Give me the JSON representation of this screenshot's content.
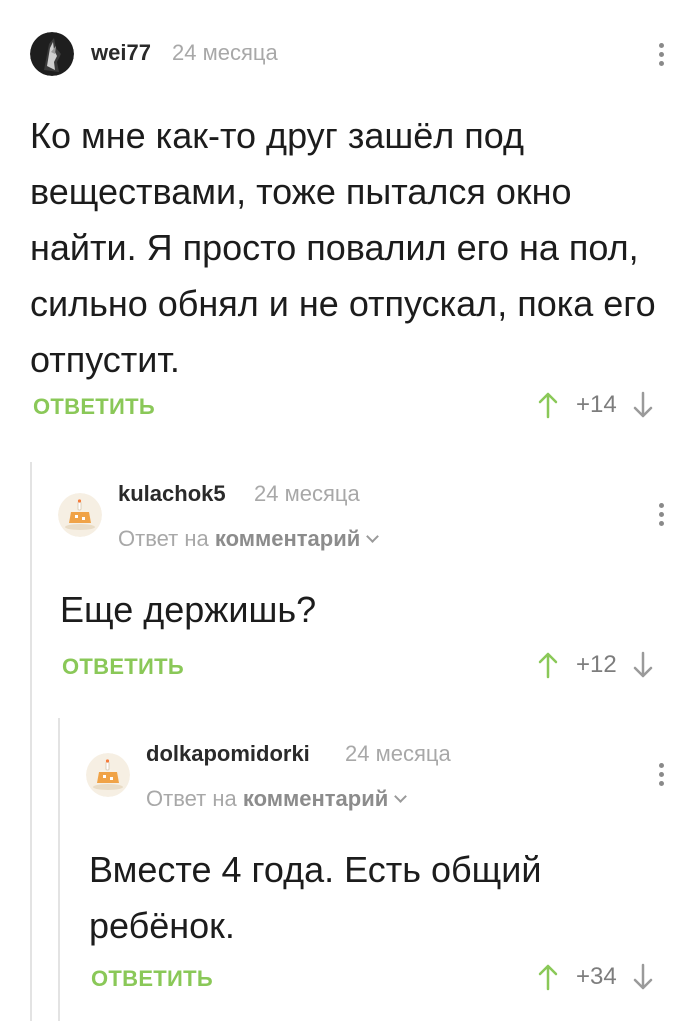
{
  "comments": [
    {
      "username": "wei77",
      "time": "24 месяца",
      "text": "Ко мне как-то друг зашёл под веществами, тоже пытался окно найти. Я просто повалил его на пол, сильно обнял и не отпускал, пока его отпустит.",
      "reply_label": "ОТВЕТИТЬ",
      "rating": "+14",
      "avatar_icon": "dark-avatar-icon"
    },
    {
      "username": "kulachok5",
      "time": "24 месяца",
      "reply_to_prefix": "Ответ на",
      "reply_to_link": "комментарий",
      "text": "Еще держишь?",
      "reply_label": "ОТВЕТИТЬ",
      "rating": "+12",
      "avatar_icon": "default-cake-avatar-icon"
    },
    {
      "username": "dolkapomidorki",
      "time": "24 месяца",
      "reply_to_prefix": "Ответ на",
      "reply_to_link": "комментарий",
      "text": "Вместе 4 года. Есть общий ребёнок.",
      "reply_label": "ОТВЕТИТЬ",
      "rating": "+34",
      "avatar_icon": "default-cake-avatar-icon"
    }
  ],
  "colors": {
    "accent_green": "#8ac858",
    "upvote_green": "#8ac858",
    "muted_text": "#a8a8a8",
    "thread_line": "#e3e3e3"
  }
}
